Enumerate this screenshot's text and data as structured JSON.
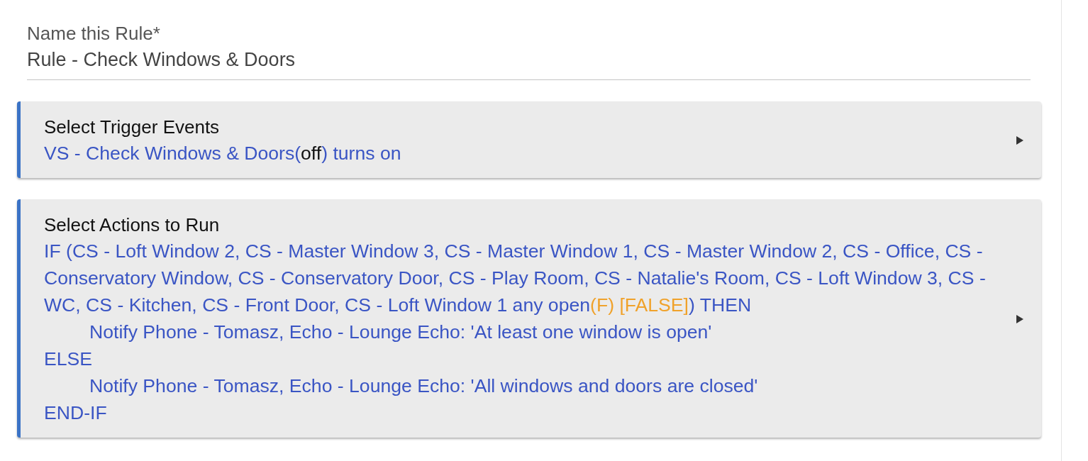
{
  "name_field": {
    "label": "Name this Rule*",
    "value": "Rule - Check Windows & Doors"
  },
  "sections": [
    {
      "title": "Select Trigger Events",
      "lines": [
        {
          "indented": false,
          "segments": [
            {
              "kind": "link",
              "text": "VS - Check Windows & Doors("
            },
            {
              "kind": "plain",
              "text": "off"
            },
            {
              "kind": "link",
              "text": ") turns on"
            }
          ]
        }
      ]
    },
    {
      "title": "Select Actions to Run",
      "lines": [
        {
          "indented": false,
          "segments": [
            {
              "kind": "link",
              "text": "IF (CS - Loft Window 2, CS - Master Window 3, CS - Master Window 1, CS - Master Window 2, CS - Office, CS - Conservatory Window, CS - Conservatory Door, CS - Play Room, CS - Natalie's Room, CS - Loft Window 3, CS - WC, CS - Kitchen, CS - Front Door, CS - Loft Window 1 any open"
            },
            {
              "kind": "status",
              "text": "(F) [FALSE]"
            },
            {
              "kind": "link",
              "text": ") THEN"
            }
          ]
        },
        {
          "indented": true,
          "segments": [
            {
              "kind": "link",
              "text": "Notify Phone - Tomasz, Echo - Lounge Echo: 'At least one window is open'"
            }
          ]
        },
        {
          "indented": false,
          "segments": [
            {
              "kind": "link",
              "text": "ELSE"
            }
          ]
        },
        {
          "indented": true,
          "segments": [
            {
              "kind": "link",
              "text": "Notify Phone - Tomasz, Echo - Lounge Echo: 'All windows and doors are closed'"
            }
          ]
        },
        {
          "indented": false,
          "segments": [
            {
              "kind": "link",
              "text": "END-IF"
            }
          ]
        }
      ]
    }
  ]
}
